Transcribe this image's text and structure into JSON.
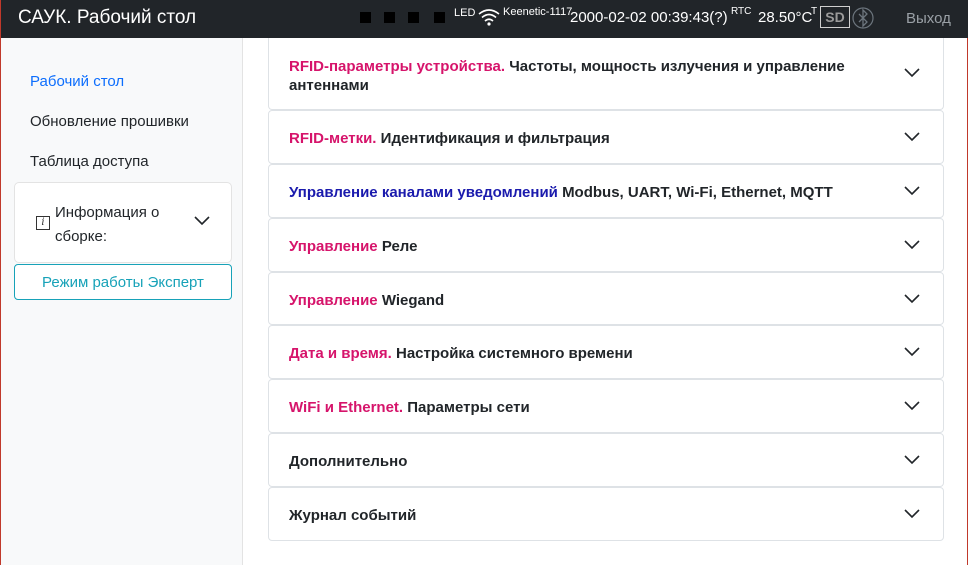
{
  "header": {
    "title": "САУК. Рабочий стол",
    "led_label": "LED",
    "network_name": "Keenetic-1117",
    "datetime": "2000-02-02 00:39:43(?)",
    "rtc_label": "RTC",
    "temperature": "28.50°C",
    "temperature_sup": "T",
    "sd_label": "SD",
    "logout_label": "Выход",
    "icons": [
      "wifi-icon",
      "bluetooth-icon"
    ]
  },
  "sidebar": {
    "items": [
      {
        "label": "Рабочий стол",
        "active": true
      },
      {
        "label": "Обновление прошивки",
        "active": false
      },
      {
        "label": "Таблица доступа",
        "active": false
      }
    ],
    "info": {
      "label": "Информация о сборке:"
    },
    "expert_button": "Режим работы Эксперт"
  },
  "colors": {
    "accent_red": "#d6146b",
    "accent_blue": "#1a1aad",
    "link_blue": "#0d6efd",
    "teal": "#17a2b8",
    "header_bg": "#212529"
  },
  "sections": [
    {
      "highlight": "RFID-параметры устройства.",
      "highlight_color": "red",
      "text": "Частоты, мощность излучения и управление антеннами"
    },
    {
      "highlight": "RFID-метки.",
      "highlight_color": "red",
      "text": "Идентификация и фильтрация"
    },
    {
      "highlight": "Управление каналами уведомлений",
      "highlight_color": "blue",
      "text": "Modbus, UART, Wi-Fi, Ethernet, MQTT"
    },
    {
      "highlight": "Управление",
      "highlight_color": "red",
      "text": "Реле"
    },
    {
      "highlight": "Управление",
      "highlight_color": "red",
      "text": "Wiegand"
    },
    {
      "highlight": "Дата и время.",
      "highlight_color": "red",
      "text": "Настройка системного времени"
    },
    {
      "highlight": "WiFi и Ethernet.",
      "highlight_color": "red",
      "text": "Параметры сети"
    },
    {
      "highlight": "",
      "highlight_color": "red",
      "text": "Дополнительно"
    },
    {
      "highlight": "",
      "highlight_color": "red",
      "text": "Журнал событий"
    }
  ]
}
